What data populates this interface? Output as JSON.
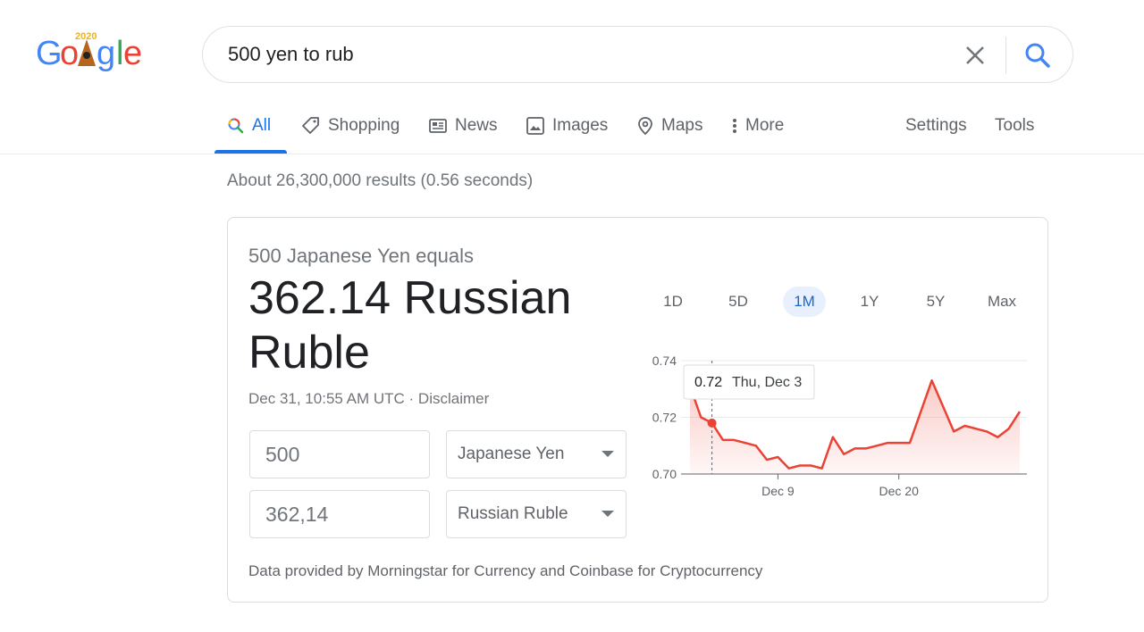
{
  "logo": {
    "alt": "Google",
    "badge": "2020"
  },
  "search": {
    "query": "500 yen to rub"
  },
  "tabs": [
    {
      "label": "All",
      "icon": "search-icon"
    },
    {
      "label": "Shopping",
      "icon": "tag-icon"
    },
    {
      "label": "News",
      "icon": "newspaper-icon"
    },
    {
      "label": "Images",
      "icon": "image-icon"
    },
    {
      "label": "Maps",
      "icon": "map-pin-icon"
    },
    {
      "label": "More",
      "icon": "more-vert-icon"
    }
  ],
  "tools": {
    "settings": "Settings",
    "tools": "Tools"
  },
  "stats": "About 26,300,000 results (0.56 seconds)",
  "converter": {
    "equals": "500 Japanese Yen equals",
    "result": "362.14 Russian Ruble",
    "timestamp": "Dec 31, 10:55 AM UTC",
    "separator": " · ",
    "disclaimer": "Disclaimer",
    "from_amount": "500",
    "from_currency": "Japanese Yen",
    "to_amount": "362,14",
    "to_currency": "Russian Ruble",
    "source": "Data provided by Morningstar for Currency and Coinbase for Cryptocurrency",
    "ranges": [
      "1D",
      "5D",
      "1M",
      "1Y",
      "5Y",
      "Max"
    ],
    "active_range": "1M"
  },
  "chart_data": {
    "type": "line",
    "x": [
      "Dec 1",
      "Dec 2",
      "Dec 3",
      "Dec 4",
      "Dec 5",
      "Dec 6",
      "Dec 7",
      "Dec 8",
      "Dec 9",
      "Dec 10",
      "Dec 11",
      "Dec 12",
      "Dec 13",
      "Dec 14",
      "Dec 15",
      "Dec 16",
      "Dec 17",
      "Dec 18",
      "Dec 19",
      "Dec 20",
      "Dec 21",
      "Dec 22",
      "Dec 23",
      "Dec 24",
      "Dec 25",
      "Dec 26",
      "Dec 27",
      "Dec 28",
      "Dec 29",
      "Dec 30",
      "Dec 31"
    ],
    "series": [
      {
        "values": [
          0.731,
          0.72,
          0.718,
          0.712,
          0.712,
          0.711,
          0.71,
          0.705,
          0.706,
          0.702,
          0.703,
          0.703,
          0.702,
          0.713,
          0.707,
          0.709,
          0.709,
          0.71,
          0.711,
          0.711,
          0.711,
          0.722,
          0.733,
          0.724,
          0.715,
          0.717,
          0.716,
          0.715,
          0.713,
          0.716,
          0.722
        ],
        "color": "#ea4335"
      }
    ],
    "ylim": [
      0.7,
      0.74
    ],
    "yticks": [
      "0.70",
      "0.72",
      "0.74"
    ],
    "xticks": [
      "Dec 9",
      "Dec 20"
    ],
    "grid": true,
    "tooltip": {
      "value": "0.72",
      "label": "Thu, Dec 3"
    },
    "highlight_index": 2
  }
}
